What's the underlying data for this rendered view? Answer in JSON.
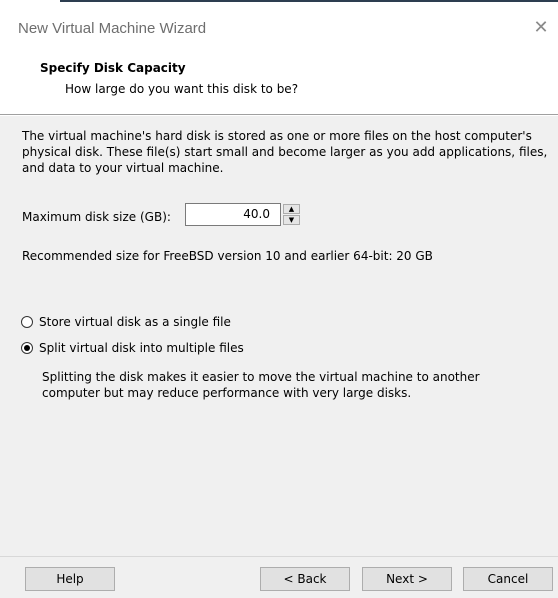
{
  "window": {
    "title": "New Virtual Machine Wizard",
    "close_glyph": "✕"
  },
  "header": {
    "title": "Specify Disk Capacity",
    "subtitle": "How large do you want this disk to be?"
  },
  "content": {
    "intro": "The virtual machine's hard disk is stored as one or more files on the host computer's physical disk. These file(s) start small and become larger as you add applications, files, and data to your virtual machine.",
    "size_label": "Maximum disk size (GB):",
    "size_value": "40.0",
    "recommended": "Recommended size for FreeBSD version 10 and earlier 64-bit: 20 GB",
    "options": [
      {
        "label": "Store virtual disk as a single file",
        "selected": false
      },
      {
        "label": "Split virtual disk into multiple files",
        "selected": true
      }
    ],
    "description": "Splitting the disk makes it easier to move the virtual machine to another computer but may reduce performance with very large disks."
  },
  "buttons": {
    "help": "Help",
    "back": "< Back",
    "next": "Next >",
    "cancel": "Cancel"
  },
  "icons": {
    "spin_up": "▲",
    "spin_down": "▼"
  }
}
